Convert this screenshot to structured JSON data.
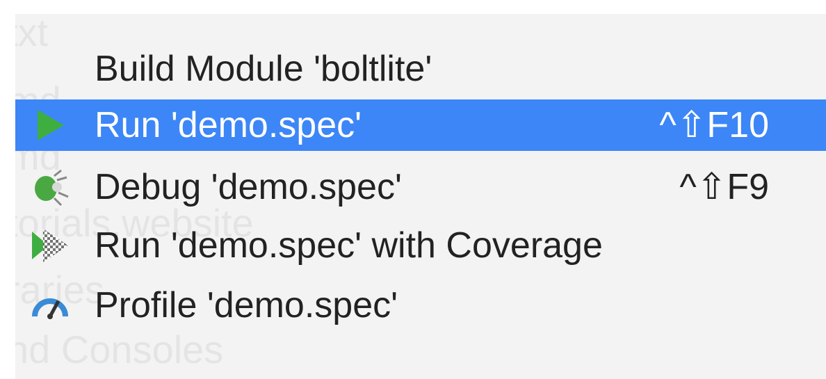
{
  "background_text": {
    "line1": "txt",
    "line2": "md",
    "line3": "md",
    "line4": "torials.website",
    "line5": "raries",
    "line6": "nd Consoles"
  },
  "menu": {
    "items": [
      {
        "label": "Build Module 'boltlite'",
        "shortcut": "",
        "icon": "none"
      },
      {
        "label": "Run 'demo.spec'",
        "shortcut": "^⇧F10",
        "icon": "run-icon",
        "selected": true
      },
      {
        "label": "Debug 'demo.spec'",
        "shortcut": "^⇧F9",
        "icon": "debug-icon"
      },
      {
        "label": "Run 'demo.spec' with Coverage",
        "shortcut": "",
        "icon": "coverage-icon"
      },
      {
        "label": "Profile 'demo.spec'",
        "shortcut": "",
        "icon": "profile-icon"
      }
    ]
  },
  "colors": {
    "selection": "#3c86f7",
    "run_green": "#3fae41",
    "debug_green": "#4aa843",
    "profile_blue": "#3a8bd6",
    "text": "#222222"
  }
}
